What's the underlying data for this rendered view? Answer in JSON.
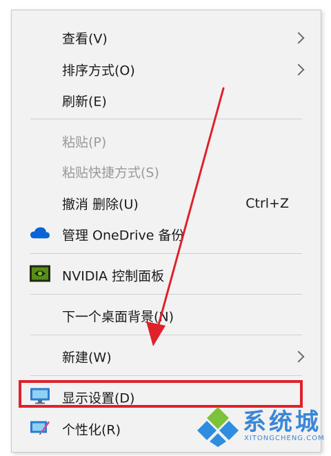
{
  "menu": {
    "items": [
      {
        "label": "查看(V)",
        "submenu": true
      },
      {
        "label": "排序方式(O)",
        "submenu": true
      },
      {
        "label": "刷新(E)"
      },
      {
        "label": "粘贴(P)",
        "disabled": true
      },
      {
        "label": "粘贴快捷方式(S)",
        "disabled": true
      },
      {
        "label": "撤消 删除(U)",
        "shortcut": "Ctrl+Z"
      },
      {
        "label": "管理 OneDrive 备份",
        "icon": "onedrive-cloud-icon"
      },
      {
        "label": "NVIDIA 控制面板",
        "icon": "nvidia-icon"
      },
      {
        "label": "下一个桌面背景(N)"
      },
      {
        "label": "新建(W)",
        "submenu": true
      },
      {
        "label": "显示设置(D)",
        "icon": "display-monitor-icon",
        "highlighted": true
      },
      {
        "label": "个性化(R)",
        "icon": "personalize-icon"
      }
    ]
  },
  "annotation": {
    "highlight_color": "#e0202a",
    "arrow_color": "#e0202a"
  },
  "watermark": {
    "title": "系统城",
    "subtitle": "XITONGCHENG.COM",
    "color": "#3a86d8"
  }
}
